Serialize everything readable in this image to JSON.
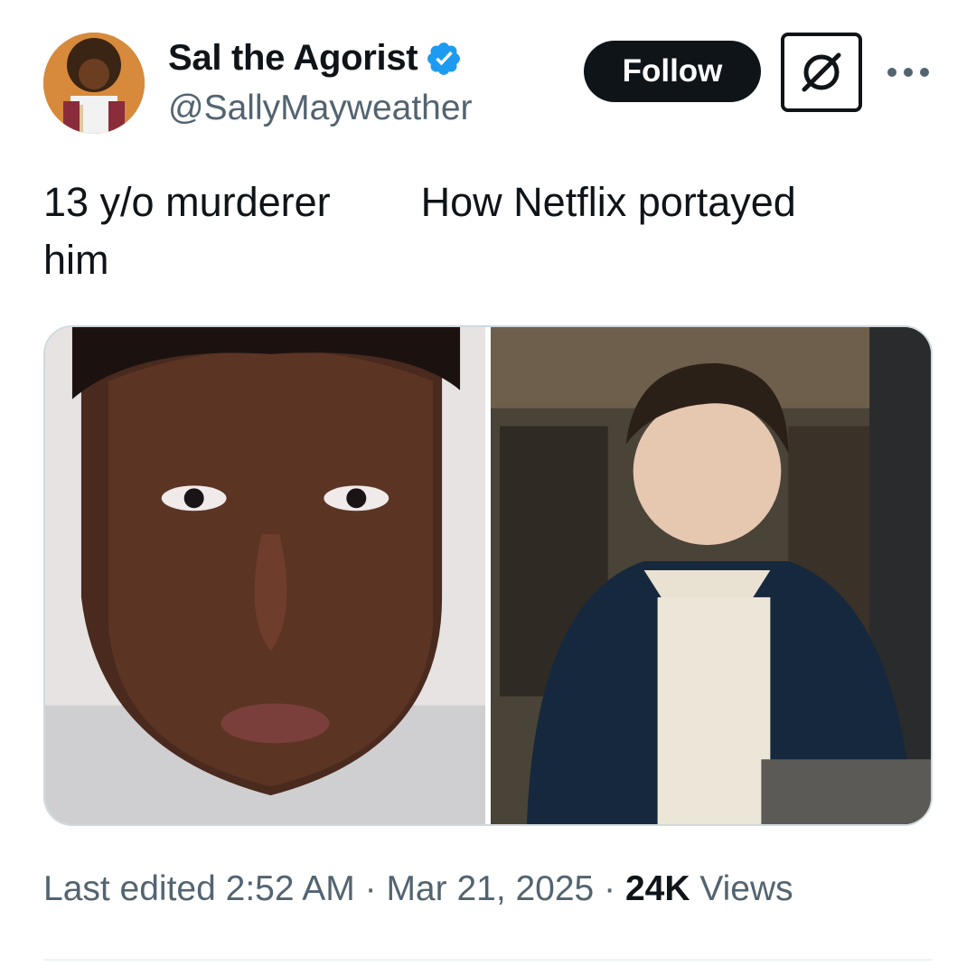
{
  "author": {
    "display_name": "Sal the Agorist",
    "handle": "@SallyMayweather",
    "verified": true,
    "verified_color": "#1d9bf0"
  },
  "actions": {
    "follow_label": "Follow",
    "grok_icon": "grok-icon",
    "more_icon": "more-dots-icon"
  },
  "tweet": {
    "text": "13 y/o murderer        How Netflix portayed\nhim",
    "images": [
      {
        "subject": "mugshot-photo"
      },
      {
        "subject": "netflix-actor-still"
      }
    ]
  },
  "meta": {
    "edited_label": "Last edited",
    "time": "2:52 AM",
    "separator": "·",
    "date": "Mar 21, 2025",
    "views_count": "24K",
    "views_label": "Views"
  },
  "colors": {
    "text_primary": "#0f1419",
    "text_secondary": "#536471",
    "border": "#cfd9de"
  }
}
